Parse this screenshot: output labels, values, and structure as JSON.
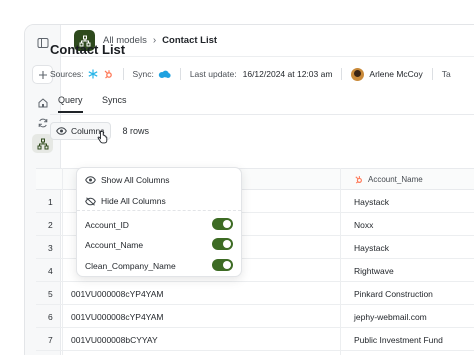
{
  "breadcrumb": {
    "root": "All models",
    "separator": "›",
    "current": "Contact List"
  },
  "page": {
    "title": "Contact List"
  },
  "meta": {
    "sources_label": "Sources:",
    "sync_label": "Sync:",
    "last_update_label": "Last update:",
    "last_update_value": "16/12/2024 at 12:03 am",
    "owner": "Arlene McCoy",
    "overflow_text": "Ta"
  },
  "tabs": [
    {
      "label": "Query",
      "active": true
    },
    {
      "label": "Syncs",
      "active": false
    }
  ],
  "toolbar": {
    "columns_label": "Columns",
    "row_count": "8 rows"
  },
  "dropdown": {
    "show_all": "Show All Columns",
    "hide_all": "Hide All Columns",
    "columns": [
      {
        "name": "Account_ID",
        "visible": true
      },
      {
        "name": "Account_Name",
        "visible": true
      },
      {
        "name": "Clean_Company_Name",
        "visible": true
      }
    ]
  },
  "table": {
    "header_name": "Account_Name",
    "rows": [
      {
        "num": "1",
        "id": "",
        "name": "Haystack"
      },
      {
        "num": "2",
        "id": "",
        "name": "Noxx"
      },
      {
        "num": "3",
        "id": "",
        "name": "Haystack"
      },
      {
        "num": "4",
        "id": "",
        "name": "Rightwave"
      },
      {
        "num": "5",
        "id": "001VU000008cYP4YAM",
        "name": "Pinkard Construction"
      },
      {
        "num": "6",
        "id": "001VU000008cYP4YAM",
        "name": "jephy-webmail.com"
      },
      {
        "num": "7",
        "id": "001VU000008bCYYAY",
        "name": "Public Investment Fund"
      }
    ]
  },
  "colors": {
    "accent": "#2e4a1d",
    "toggle_on": "#3d6b24",
    "hubspot": "#ff7a59",
    "salesforce": "#1ea1e0"
  }
}
